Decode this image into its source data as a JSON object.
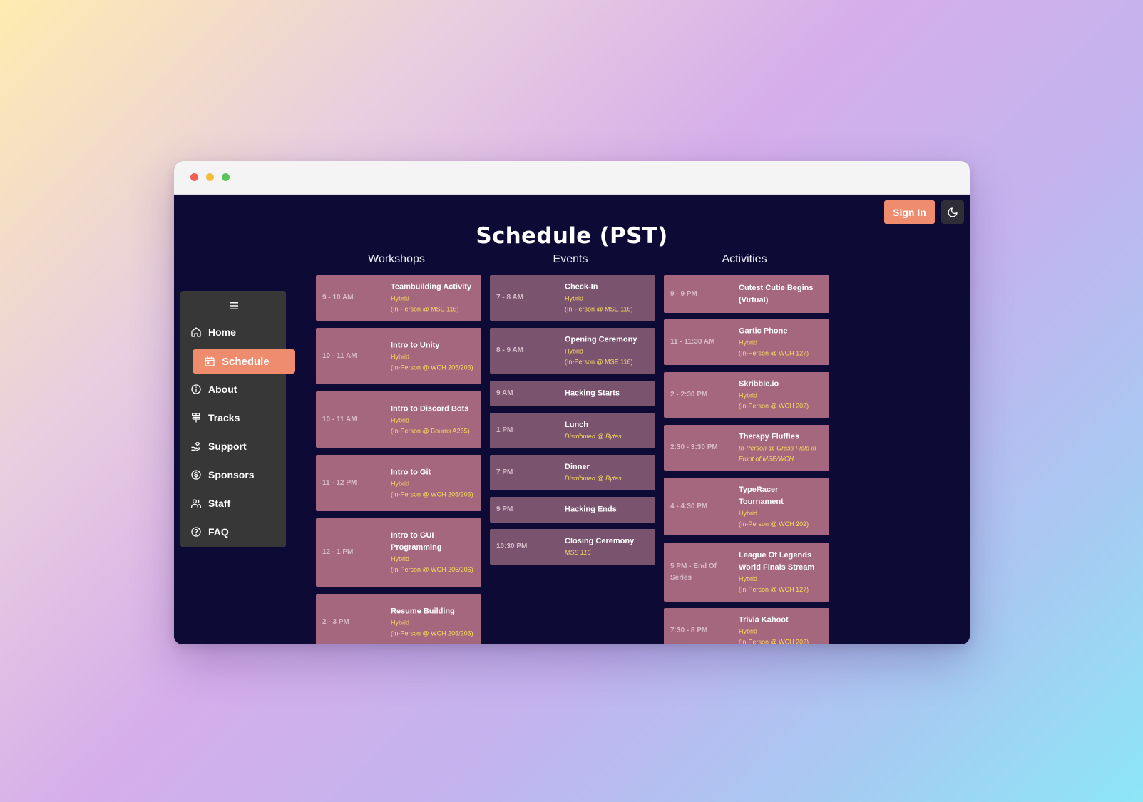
{
  "header": {
    "signin_label": "Sign In"
  },
  "page": {
    "title": "Schedule (PST)"
  },
  "columns": {
    "workshops": "Workshops",
    "events": "Events",
    "activities": "Activities"
  },
  "sidebar": {
    "items": [
      {
        "label": "Home",
        "icon": "home-icon"
      },
      {
        "label": "Schedule",
        "icon": "calendar-icon",
        "active": true
      },
      {
        "label": "About",
        "icon": "info-icon"
      },
      {
        "label": "Tracks",
        "icon": "signpost-icon"
      },
      {
        "label": "Support",
        "icon": "hand-heart-icon"
      },
      {
        "label": "Sponsors",
        "icon": "dollar-icon"
      },
      {
        "label": "Staff",
        "icon": "users-icon"
      },
      {
        "label": "FAQ",
        "icon": "help-icon"
      }
    ]
  },
  "workshops": [
    {
      "time": "9 - 10 AM",
      "title": "Teambuilding Activity",
      "mode": "Hybrid",
      "location": "(In-Person @ MSE 116)"
    },
    {
      "time": "10 - 11 AM",
      "title": "Intro to Unity",
      "mode": "Hybrid",
      "location": "(In-Person @ WCH 205/206)"
    },
    {
      "time": "10 - 11 AM",
      "title": "Intro to Discord Bots",
      "mode": "Hybrid",
      "location": "(In-Person @ Bourns A265)"
    },
    {
      "time": "11 - 12 PM",
      "title": "Intro to Git",
      "mode": "Hybrid",
      "location": "(In-Person @ WCH 205/206)"
    },
    {
      "time": "12 - 1 PM",
      "title": "Intro to GUI Programming",
      "mode": "Hybrid",
      "location": "(In-Person @ WCH 205/206)"
    },
    {
      "time": "2 - 3 PM",
      "title": "Resume Building",
      "mode": "Hybrid",
      "location": "(In-Person @ WCH 205/206)"
    }
  ],
  "events": [
    {
      "time": "7 - 8 AM",
      "title": "Check-In",
      "mode": "Hybrid",
      "location": "(In-Person @ MSE 116)"
    },
    {
      "time": "8 - 9 AM",
      "title": "Opening Ceremony",
      "mode": "Hybrid",
      "location": "(In-Person @ MSE 116)"
    },
    {
      "time": "9 AM",
      "title": "Hacking Starts"
    },
    {
      "time": "1 PM",
      "title": "Lunch",
      "note": "Distributed @ Bytes"
    },
    {
      "time": "7 PM",
      "title": "Dinner",
      "note": "Distributed @ Bytes"
    },
    {
      "time": "9 PM",
      "title": "Hacking Ends"
    },
    {
      "time": "10:30 PM",
      "title": "Closing Ceremony",
      "note": "MSE 116"
    }
  ],
  "activities": [
    {
      "time": "9 - 9 PM",
      "title": "Cutest Cutie Begins (Virtual)"
    },
    {
      "time": "11 - 11:30 AM",
      "title": "Gartic Phone",
      "mode": "Hybrid",
      "location": "(In-Person @ WCH 127)"
    },
    {
      "time": "2 - 2:30 PM",
      "title": "Skribble.io",
      "mode": "Hybrid",
      "location": "(In-Person @ WCH 202)"
    },
    {
      "time": "2:30 - 3:30 PM",
      "title": "Therapy Fluffies",
      "note": "In-Person @ Grass Field in Front of MSE/WCH"
    },
    {
      "time": "4 - 4:30 PM",
      "title": "TypeRacer Tournament",
      "mode": "Hybrid",
      "location": "(In-Person @ WCH 202)"
    },
    {
      "time": "5 PM - End Of Series",
      "title": "League Of Legends World Finals Stream",
      "mode": "Hybrid",
      "location": "(In-Person @ WCH 127)"
    },
    {
      "time": "7:30 - 8 PM",
      "title": "Trivia Kahoot",
      "mode": "Hybrid",
      "location": "(In-Person @ WCH 202)"
    }
  ],
  "colors": {
    "page_bg": "#0e0a36",
    "accent": "#ef8c6e",
    "card_workshop": "#a4677e",
    "card_event": "#7a546f",
    "location_text": "#f7d95d",
    "sidebar_bg": "#373738"
  }
}
